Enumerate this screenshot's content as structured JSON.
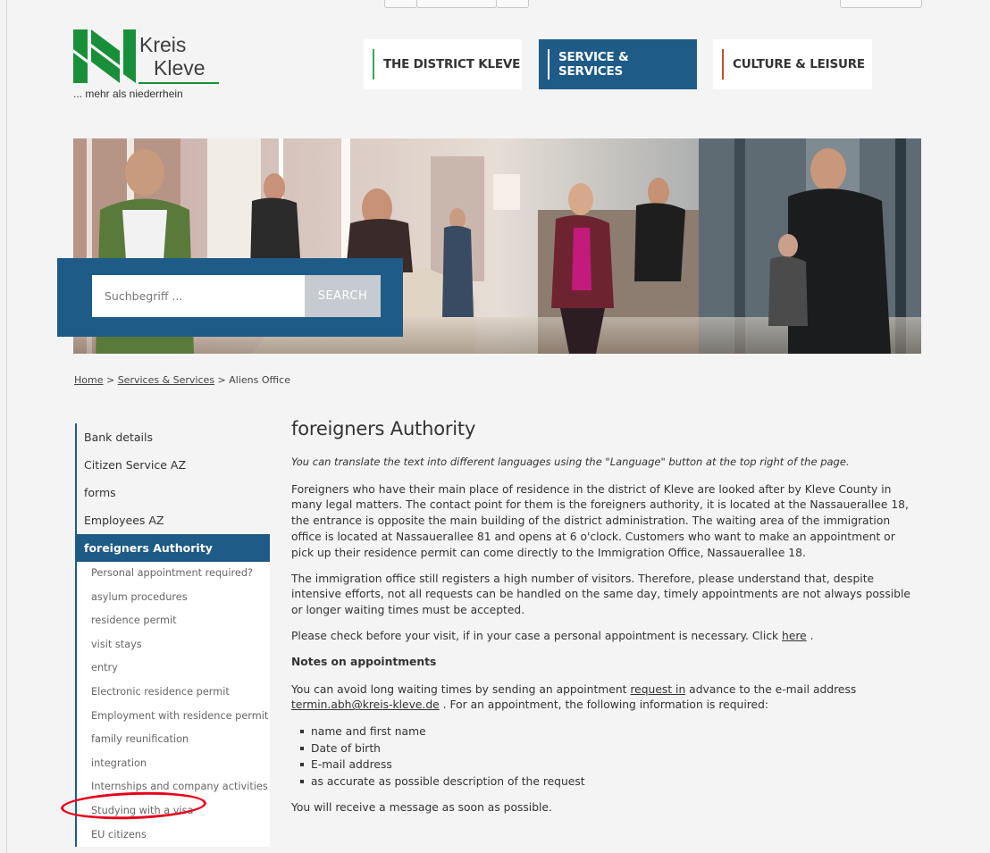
{
  "logo": {
    "line1": "Kreis",
    "line2": "Kleve",
    "tagline": "... mehr als niederrhein"
  },
  "nav": [
    {
      "label": "THE DISTRICT KLEVE",
      "accent": "#3aa35a"
    },
    {
      "label": "SERVICE & SERVICES",
      "accent": "#ffffff"
    },
    {
      "label": "CULTURE & LEISURE",
      "accent": "#b5532c"
    }
  ],
  "search": {
    "placeholder": "Suchbegriff ...",
    "button": "SEARCH"
  },
  "breadcrumb": {
    "home": "Home",
    "sep1": " > ",
    "section": "Services & Services",
    "sep2": " > ",
    "current": "Aliens Office"
  },
  "sidebar": {
    "items": [
      "Bank details",
      "Citizen Service AZ",
      "forms",
      "Employees AZ"
    ],
    "active": "foreigners Authority",
    "subitems": [
      "Personal appointment required?",
      "asylum procedures",
      "residence permit",
      "visit stays",
      "entry",
      "Electronic residence permit",
      "Employment with residence permit",
      "family reunification",
      "integration",
      "Internships and company activities",
      "Studying with a visa",
      "EU citizens"
    ]
  },
  "content": {
    "title": "foreigners Authority",
    "intro": "You can translate the text into different languages using the \"Language\" button at the top right of the page.",
    "p1": "Foreigners who have their main place of residence in the district of Kleve are looked after by Kleve County in many legal matters. The contact point for them is the foreigners authority, it is located at the Nassauerallee 18, the entrance is opposite the main building of the district administration. The waiting area of the immigration office is located at Nassauerallee 81 and opens at 6 o'clock. Customers who want to make an appointment or pick up their residence permit can come directly to the Immigration Office, Nassauerallee 18.",
    "p2": "The immigration office still registers a high number of visitors. Therefore, please understand that, despite intensive efforts, not all requests can be handled on the same day, timely appointments are not always possible or longer waiting times must be accepted.",
    "p3_before": "Please check before your visit, if in your case a personal appointment is necessary. Click ",
    "p3_link": "here",
    "p3_after": " .",
    "notes_heading": "Notes on appointments",
    "p4_before": "You can avoid long waiting times by sending an appointment ",
    "p4_link": "request in",
    "p4_mid": " advance to the e-mail address ",
    "p4_email": "termin.abh@kreis-kleve.de",
    "p4_after": " . For an appointment, the following information is required:",
    "list": [
      "name and first name",
      "Date of birth",
      "E-mail address",
      "as accurate as possible description of the request"
    ],
    "p5": "You will receive a message as soon as possible."
  },
  "colors": {
    "brand_blue": "#1e5b86",
    "logo_green": "#1a8f3a",
    "annotation_red": "#e8001c"
  }
}
